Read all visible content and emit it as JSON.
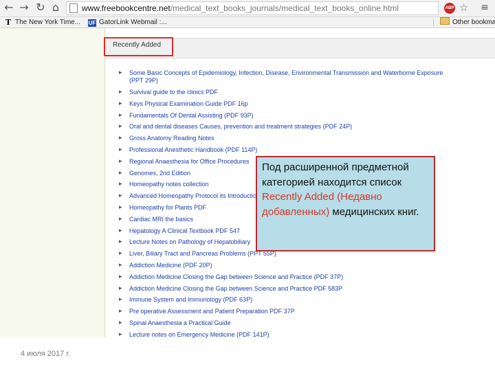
{
  "browser": {
    "url_host": "www.freebookcentre.net",
    "url_path": "/medical_text_books_journals/medical_text_books_online.html",
    "extension_label": "ABP",
    "back_glyph": "←",
    "forward_glyph": "→",
    "reload_glyph": "↻",
    "home_glyph": "⌂",
    "star_glyph": "☆",
    "menu_glyph": "≡"
  },
  "bookmarks": [
    {
      "label": "The New York Time...",
      "icon": "nyt-logo-icon",
      "icon_glyph": "T"
    },
    {
      "label": "GatorLink Webmail :...",
      "icon": "gatorlink-icon",
      "icon_glyph": "UF"
    },
    {
      "label": "Other bookma",
      "icon": "folder-icon",
      "icon_glyph": ""
    }
  ],
  "section": {
    "title": "Recently Added"
  },
  "books": [
    "Some Basic Concepts of Epidemiology, Infection, Disease, Environmental Transmission and Waterborne Exposure (PPT 29P)",
    "Survival guide to the clinics PDF",
    "Keys Physical Examination Guide PDF 16p",
    "Fundamentals Of Dental Assisting (PDF 93P)",
    "Oral and dental diseases Causes, prevention and treatment strategies (PDF 24P)",
    "Gross Anatomy Reading Notes",
    "Professional Anesthetic Handbook (PDF 114P)",
    "Regional Anaesthesia for Office Procedures",
    "Genomes, 2nd Edition",
    "Homeopathy notes collection",
    "Advanced Homeopathy Protocol its Introduction",
    "Homeopathy for Plants PDF",
    "Cardiac MRI the basics",
    "Hepatology A Clinical Textbook PDF 547",
    "Lecture Notes on Pathology of Hepatobiliary",
    "Liver, Biliary Tract and Pancreas Problems (PPT 55P)",
    "Addiction Medicine (PDF 20P)",
    "Addiction Medicine Closing the Gap between Science and Practice (PDF 37P)",
    "Addiction Medicine Closing the Gap between Science and Practice PDF 583P",
    "Immune System and Immunology (PDF 63P)",
    "Pre operative Assessment and Patient Preparation PDF 37P",
    "Spinal Anaesthesia a Practical Guide",
    "Lecture notes on Emergency Medicine (PDF 141P)"
  ],
  "callout": {
    "text_before": "Под расширенной предметной категорией находится список ",
    "text_accent": "Recently Added (Недавно добавленных)",
    "text_after": " медицинских книг."
  },
  "footer": {
    "date": "4 июля 2017 г."
  },
  "colors": {
    "link": "#1a3fa6",
    "highlight_border": "#e02a2a",
    "callout_bg": "#b7dde8",
    "callout_accent": "#d0392b",
    "page_bg": "#f7f9ec"
  }
}
